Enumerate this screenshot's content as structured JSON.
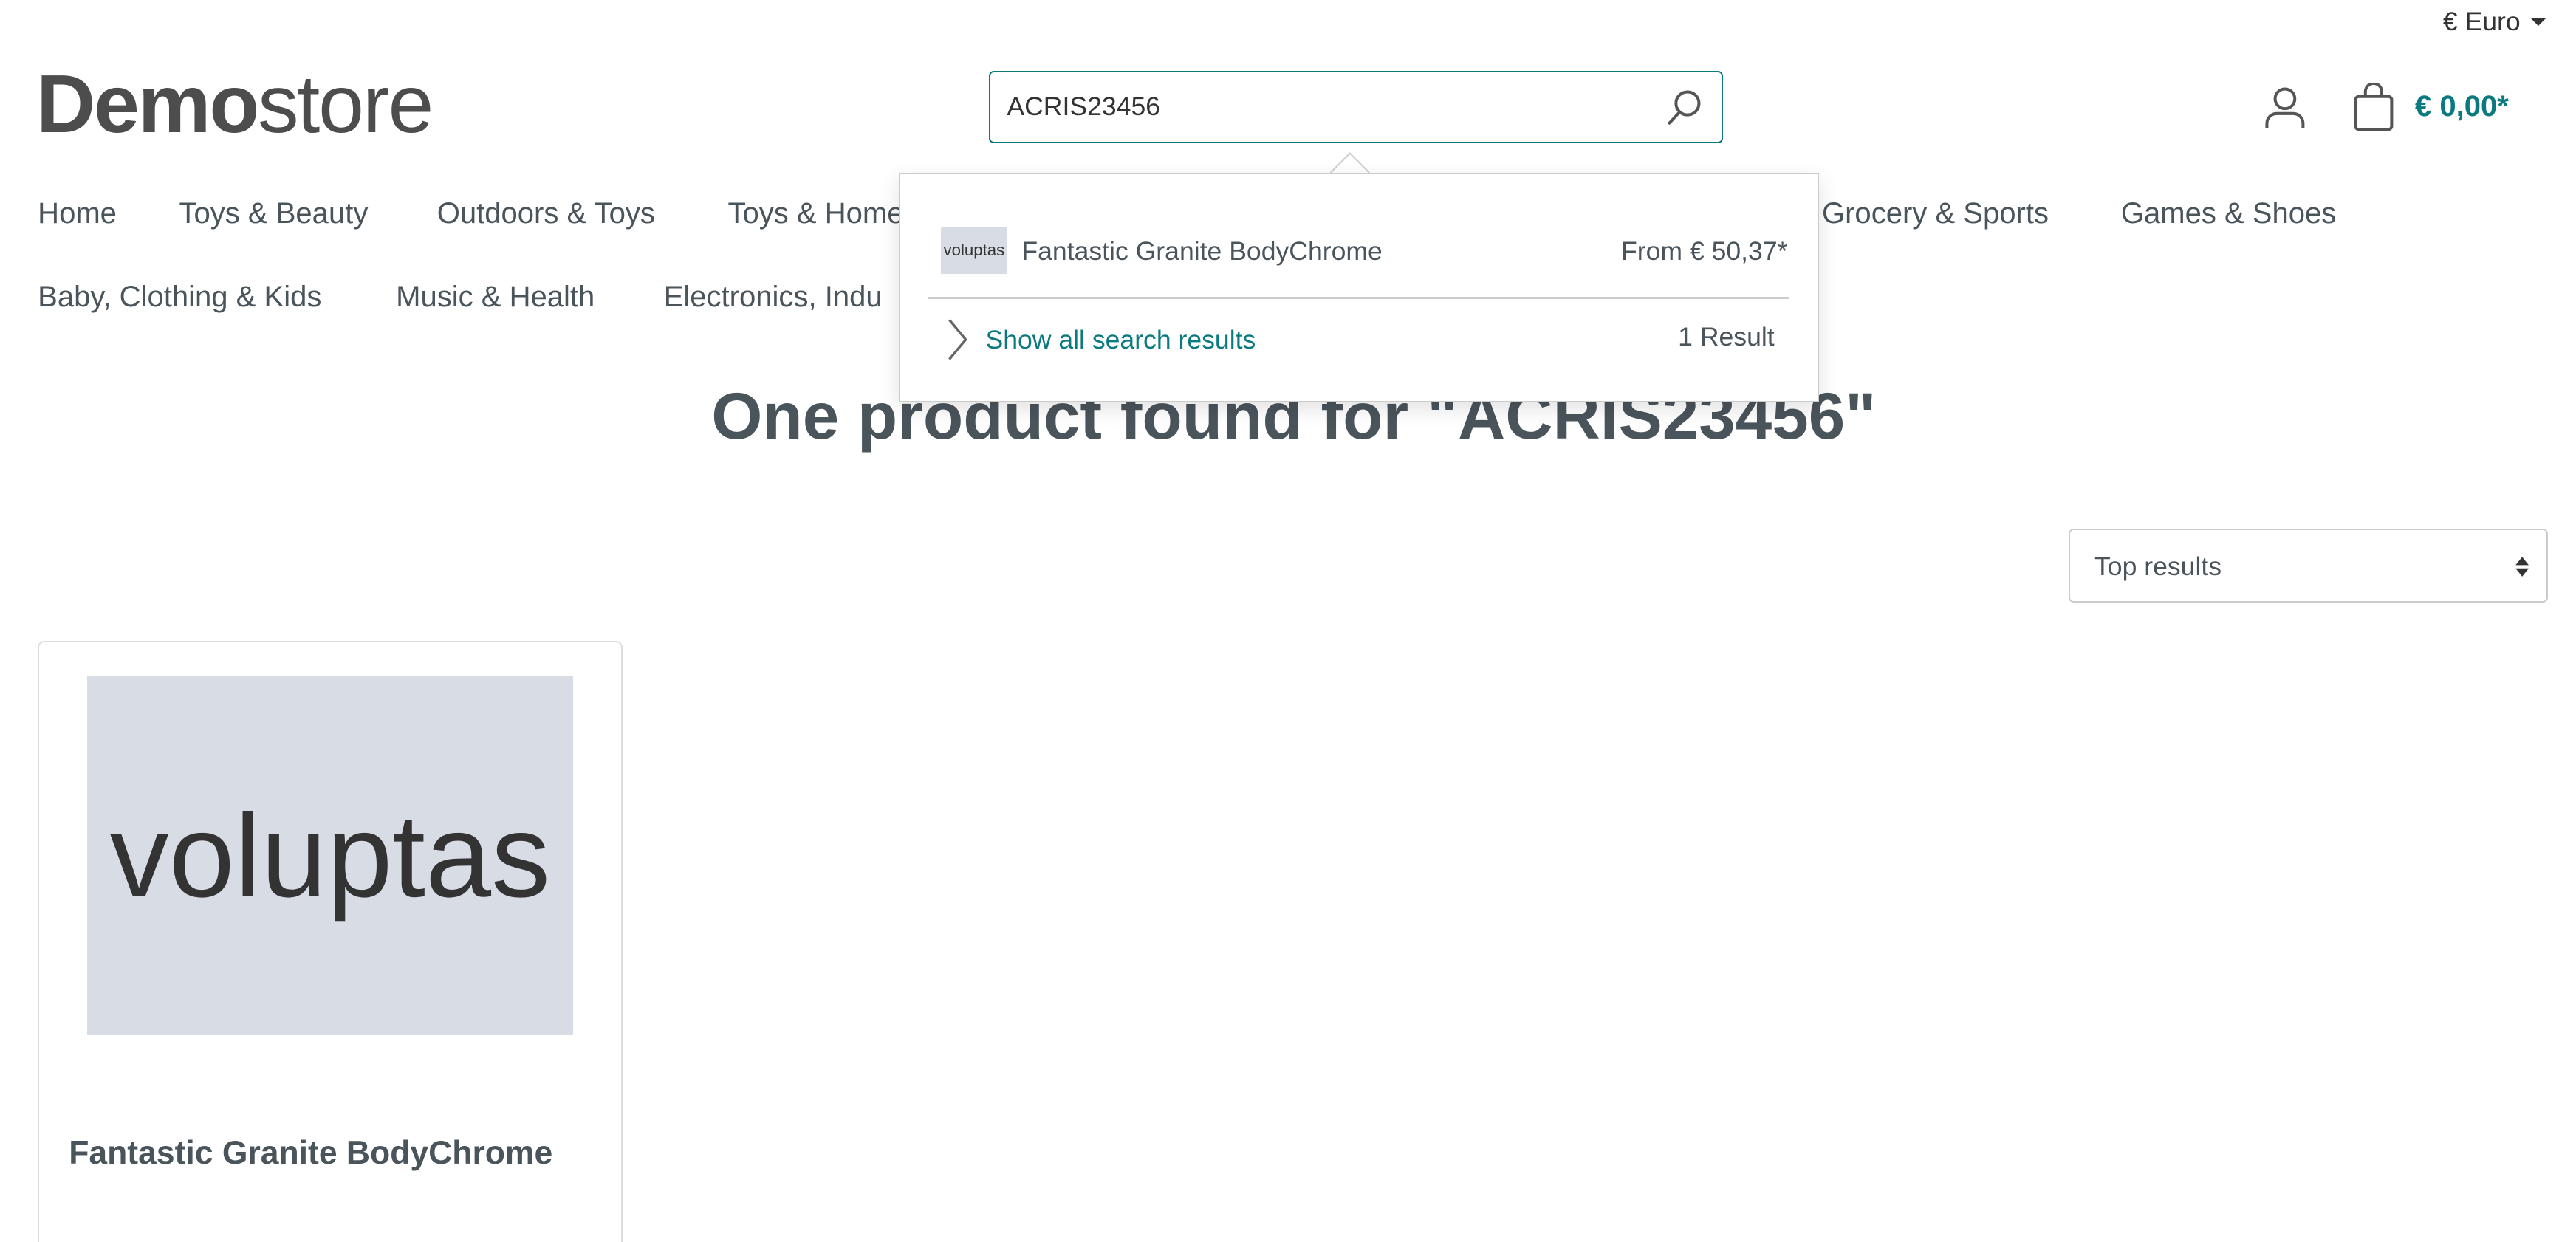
{
  "header": {
    "currency": "€ Euro",
    "logo": {
      "bold": "Demo",
      "light": "store"
    },
    "search": {
      "value": "ACRIS23456",
      "placeholder": ""
    },
    "cart_total": "€ 0,00*"
  },
  "nav": {
    "row1": [
      "Home",
      "Toys & Beauty",
      "Outdoors & Toys",
      "Toys & Home",
      "Grocery & Sports",
      "Games & Shoes"
    ],
    "row2": [
      "Baby, Clothing & Kids",
      "Music & Health",
      "Electronics, Indu"
    ]
  },
  "suggest": {
    "item": {
      "thumb": "voluptas",
      "name": "Fantastic Granite BodyChrome",
      "price": "From € 50,37*"
    },
    "show_all": "Show all search results",
    "count": "1 Result"
  },
  "main": {
    "heading": "One product found for \"ACRIS23456\"",
    "sort": "Top results",
    "products": [
      {
        "image_text": "voluptas",
        "name": "Fantastic Granite BodyChrome"
      }
    ]
  },
  "colors": {
    "accent": "#0b7a80",
    "text": "#4a545b",
    "placeholder_bg": "#d8dce5"
  }
}
